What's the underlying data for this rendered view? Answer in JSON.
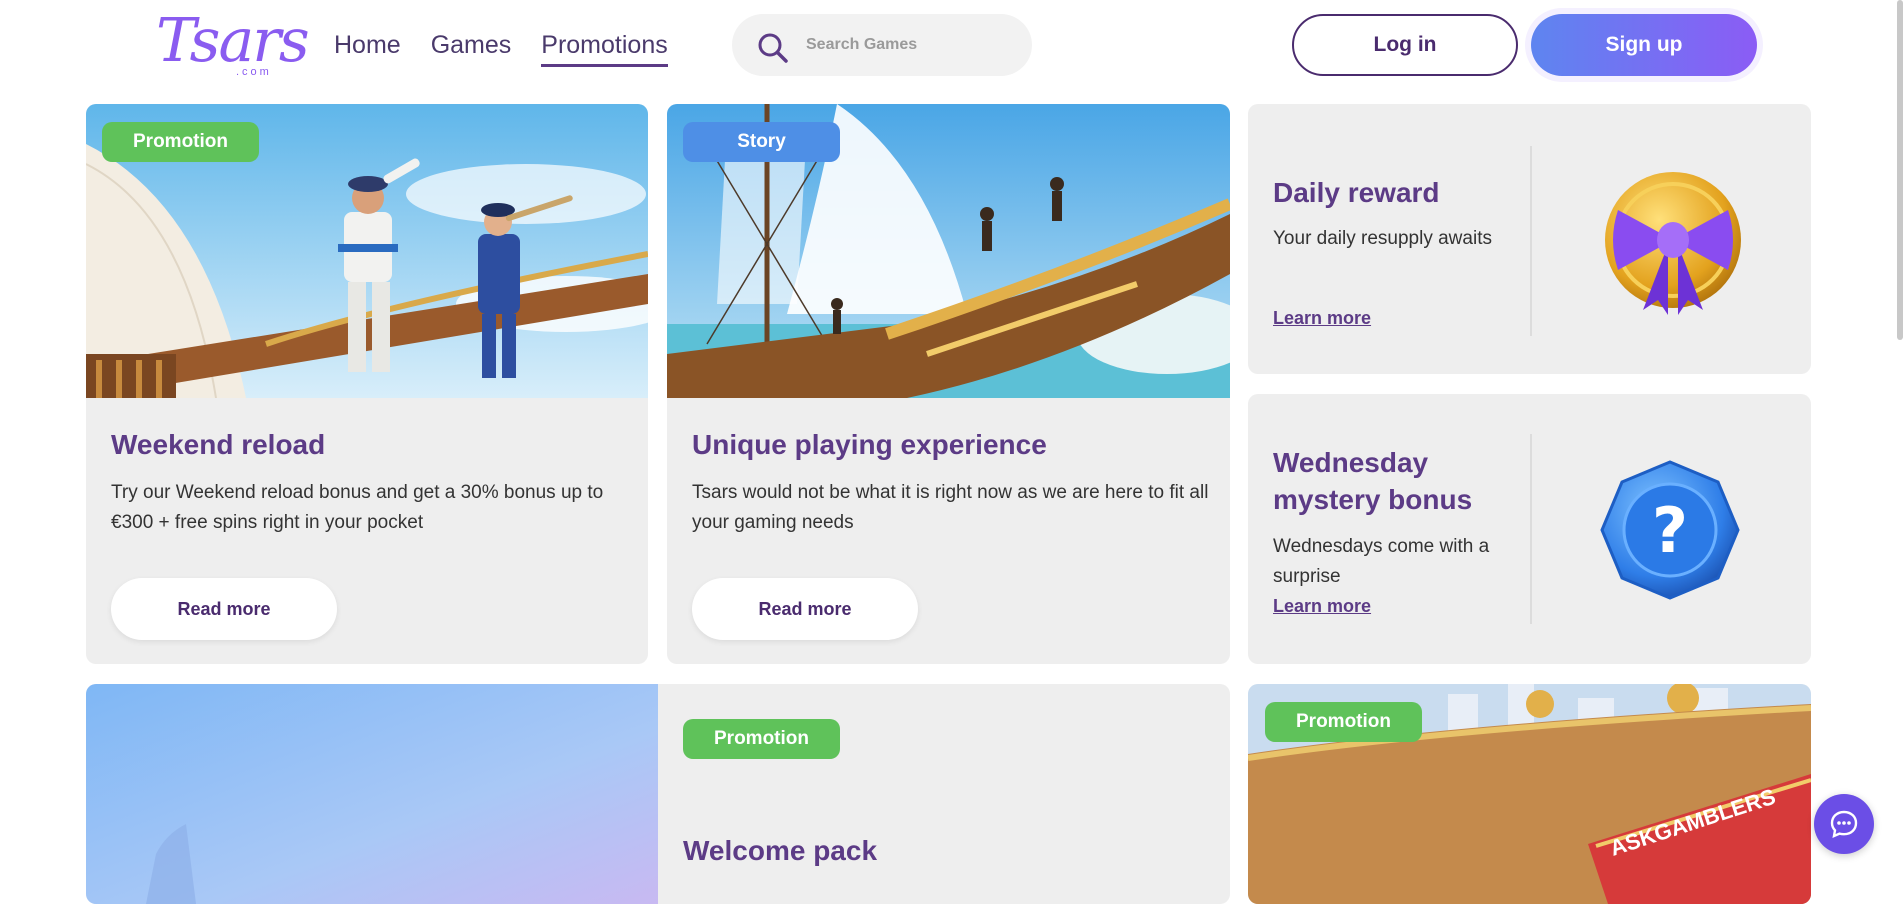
{
  "header": {
    "logo": "Tsars",
    "logo_sub": ".com",
    "nav": [
      {
        "label": "Home"
      },
      {
        "label": "Games"
      },
      {
        "label": "Promotions"
      }
    ],
    "search_placeholder": "Search Games",
    "login_label": "Log in",
    "signup_label": "Sign up"
  },
  "cards": {
    "weekend": {
      "badge": "Promotion",
      "title": "Weekend reload",
      "desc": "Try our Weekend reload bonus and get a 30% bonus up to €300 + free spins right in your pocket",
      "button": "Read more"
    },
    "story": {
      "badge": "Story",
      "title": "Unique playing experience",
      "desc": "Tsars would not be what it is right now as we are here to fit all your gaming needs",
      "button": "Read more"
    },
    "daily": {
      "title": "Daily reward",
      "desc": "Your daily resupply awaits",
      "link": "Learn more"
    },
    "wednesday": {
      "title": "Wednesday mystery bonus",
      "desc": "Wednesdays come with a surprise",
      "link": "Learn more"
    },
    "welcome": {
      "badge": "Promotion",
      "title": "Welcome pack"
    },
    "askgamblers": {
      "badge": "Promotion",
      "sign_text": "ASKGAMBLERS"
    }
  },
  "colors": {
    "accent": "#5c3b86",
    "promotion_badge": "#5fc25a",
    "story_badge": "#4e8fe6",
    "signup_start": "#5e85f0",
    "signup_end": "#8b5cf5"
  }
}
